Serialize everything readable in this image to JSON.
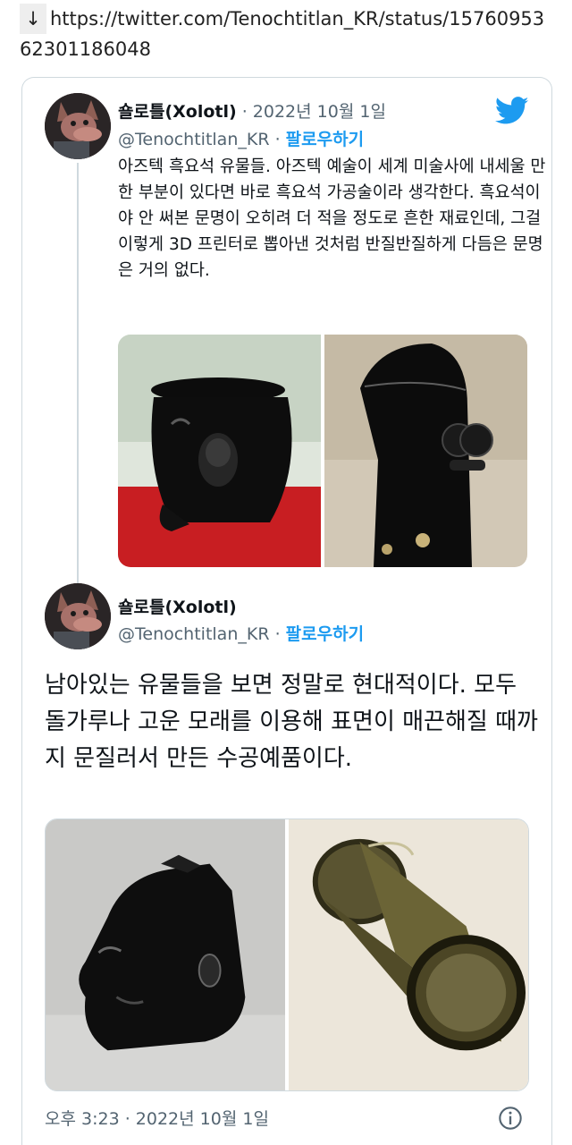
{
  "url_line": {
    "arrow": "↓",
    "url": "https://twitter.com/Tenochtitlan_KR/status/1576095362301186048"
  },
  "tweet1": {
    "name": "숄로틀(Xolotl)",
    "date": " · 2022년 10월 1일",
    "handle": "@Tenochtitlan_KR · ",
    "follow": "팔로우하기",
    "text": "아즈텍 흑요석 유물들. 아즈텍 예술이 세계 미술사에 내세울 만한 부분이 있다면 바로 흑요석 가공술이라 생각한다. 흑요석이야 안 써본 문명이 오히려 더 적을 정도로 흔한 재료인데, 그걸 이렇게 3D 프린터로 뽑아낸 것처럼 반질반질하게 다듬은 문명은 거의 없다."
  },
  "tweet2": {
    "name": "숄로틀(Xolotl)",
    "handle": "@Tenochtitlan_KR · ",
    "follow": "팔로우하기",
    "text": "남아있는 유물들을 보면 정말로 현대적이다. 모두 돌가루나 고운 모래를 이용해 표면이 매끈해질 때까지 문질러서 만든 수공예품이다."
  },
  "footer": {
    "timestamp": "오후 3:23 · 2022년 10월 1일"
  },
  "icons": {
    "brand": "twitter-bird-icon",
    "info": "info-icon"
  },
  "colors": {
    "accent": "#1d9bf0",
    "secondary_text": "#536471",
    "border": "#cfd9de"
  }
}
